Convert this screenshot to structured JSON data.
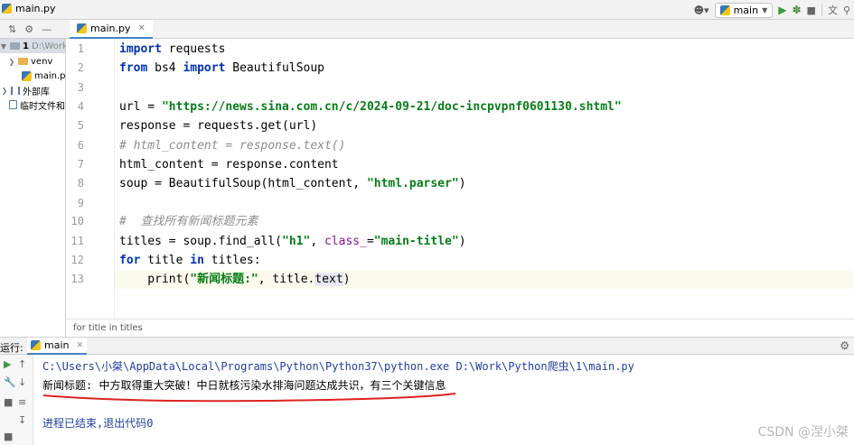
{
  "window": {
    "file_title": "main.py",
    "run_config": "main",
    "user_icon": "user-icon",
    "run_icon": "run-icon",
    "debug_icon": "debug-icon",
    "translate_icon": "translate-icon",
    "search_icon": "search-icon"
  },
  "project": {
    "root_number": "1",
    "root_path": "D:\\Work",
    "items": [
      {
        "label": "venv"
      },
      {
        "label": "main.py"
      },
      {
        "label": "外部库"
      },
      {
        "label": "临时文件和"
      }
    ]
  },
  "editor": {
    "tab_label": "main.py",
    "line_numbers": [
      "1",
      "2",
      "3",
      "4",
      "5",
      "6",
      "7",
      "8",
      "9",
      "10",
      "11",
      "12",
      "13"
    ],
    "code": {
      "l1_kw": "import",
      "l1_rest": " requests",
      "l2_kw1": "from",
      "l2_mod": " bs4 ",
      "l2_kw2": "import",
      "l2_rest": " BeautifulSoup",
      "l4_a": "url = ",
      "l4_str": "\"https://news.sina.com.cn/c/2024-09-21/doc-incpvpnf0601130.shtml\"",
      "l5": "response = requests.get(url)",
      "l6": "# html_content = response.text()",
      "l7": "html_content = response.content",
      "l8_a": "soup = BeautifulSoup(html_content, ",
      "l8_str": "\"html.parser\"",
      "l8_b": ")",
      "l10": "#  查找所有新闻标题元素",
      "l11_a": "titles = soup.find_all(",
      "l11_s1": "\"h1\"",
      "l11_b": ", ",
      "l11_param": "class_",
      "l11_c": "=",
      "l11_s2": "\"main-title\"",
      "l11_d": ")",
      "l12_kw1": "for",
      "l12_a": " title ",
      "l12_kw2": "in",
      "l12_b": " titles:",
      "l13_a": "    print(",
      "l13_str": "\"新闻标题:\"",
      "l13_b": ", title.",
      "l13_hl": "text",
      "l13_c": ")"
    },
    "breadcrumb": "for title in titles"
  },
  "run": {
    "panel_label": "运行:",
    "tab_label": "main",
    "console": [
      "C:\\Users\\小桀\\AppData\\Local\\Programs\\Python\\Python37\\python.exe D:\\Work\\Python爬虫\\1\\main.py",
      "新闻标题: 中方取得重大突破！中日就核污染水排海问题达成共识，有三个关键信息",
      "",
      "进程已结束,退出代码0"
    ]
  },
  "watermark": "CSDN @涅小桀"
}
